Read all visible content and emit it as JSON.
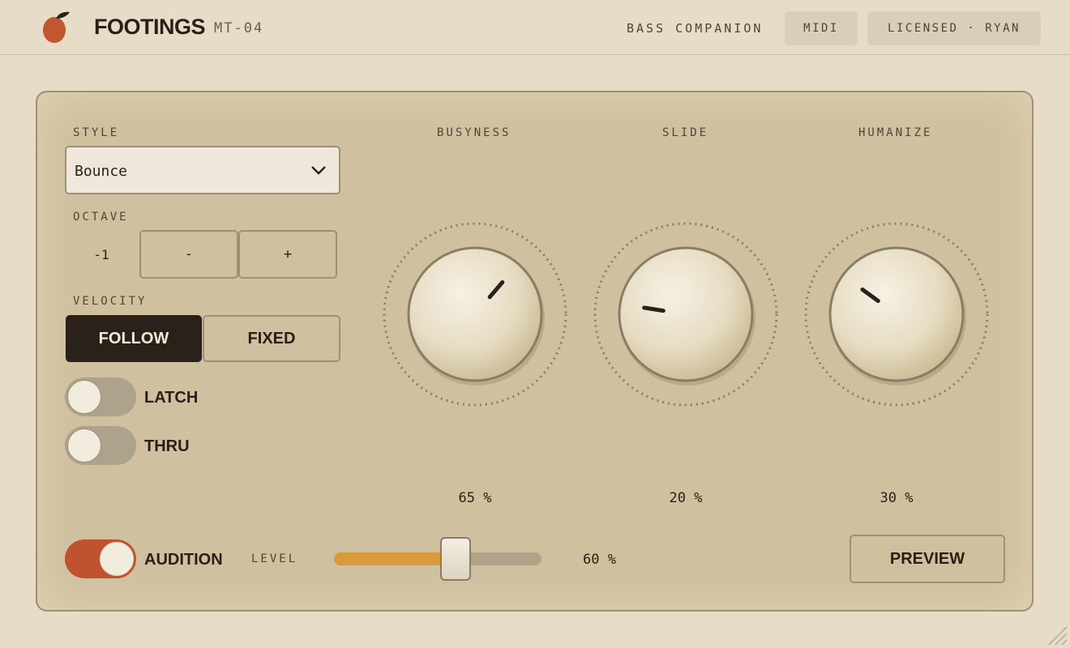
{
  "header": {
    "brand": "FOOTINGS",
    "model": "MT-04",
    "subtitle": "BASS COMPANION",
    "midi_label": "MIDI",
    "license_label": "LICENSED · RYAN",
    "logo_icon": "apple-logo-icon"
  },
  "style": {
    "label": "STYLE",
    "value": "Bounce",
    "icon": "chevron-down-icon"
  },
  "octave": {
    "label": "OCTAVE",
    "value": "-1",
    "minus_label": "-",
    "plus_label": "+"
  },
  "velocity": {
    "label": "VELOCITY",
    "options": [
      "FOLLOW",
      "FIXED"
    ],
    "selected": "FOLLOW"
  },
  "toggles": {
    "latch": {
      "label": "LATCH",
      "on": false
    },
    "thru": {
      "label": "THRU",
      "on": false
    },
    "audition": {
      "label": "AUDITION",
      "on": true
    }
  },
  "knobs": [
    {
      "label": "BUSYNESS",
      "value": 65,
      "display": "65 %"
    },
    {
      "label": "SLIDE",
      "value": 20,
      "display": "20 %"
    },
    {
      "label": "HUMANIZE",
      "value": 30,
      "display": "30 %"
    }
  ],
  "level": {
    "label": "LEVEL",
    "value": 60,
    "display": "60 %"
  },
  "preview_label": "PREVIEW",
  "colors": {
    "background": "#e6dcc7",
    "panel": "#cfc09f",
    "accent_orange": "#bf5330",
    "slider_fill": "#d89a3c",
    "dark": "#2b211b"
  }
}
